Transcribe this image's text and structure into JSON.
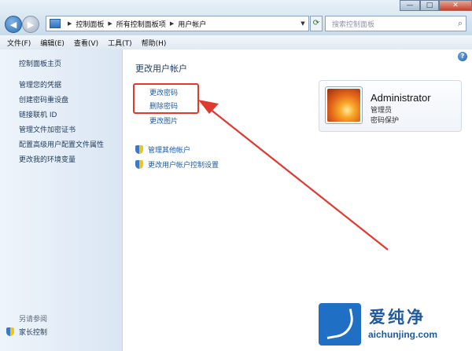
{
  "window": {
    "breadcrumb": [
      "控制面板",
      "所有控制面板项",
      "用户帐户"
    ],
    "search_placeholder": "搜索控制面板",
    "controls": {
      "min": "—",
      "max": "□",
      "close": "✕"
    }
  },
  "menubar": [
    "文件(F)",
    "编辑(E)",
    "查看(V)",
    "工具(T)",
    "帮助(H)"
  ],
  "sidebar": {
    "home": "控制面板主页",
    "links": [
      "管理您的凭据",
      "创建密码重设盘",
      "链接联机 ID",
      "管理文件加密证书",
      "配置高级用户配置文件属性",
      "更改我的环境变量"
    ],
    "see_also_title": "另请参阅",
    "see_also_items": [
      "家长控制"
    ]
  },
  "main": {
    "title": "更改用户帐户",
    "tasks": [
      "更改密码",
      "删除密码",
      "更改图片"
    ],
    "shield_links": [
      "管理其他帐户",
      "更改用户帐户控制设置"
    ]
  },
  "user": {
    "name": "Administrator",
    "role": "管理员",
    "status": "密码保护"
  },
  "watermark": {
    "text": "爱纯净",
    "url": "aichunjing.com"
  },
  "colors": {
    "highlight": "#e03a2e",
    "link": "#1f5a9e",
    "accent": "#1f6fc4"
  }
}
